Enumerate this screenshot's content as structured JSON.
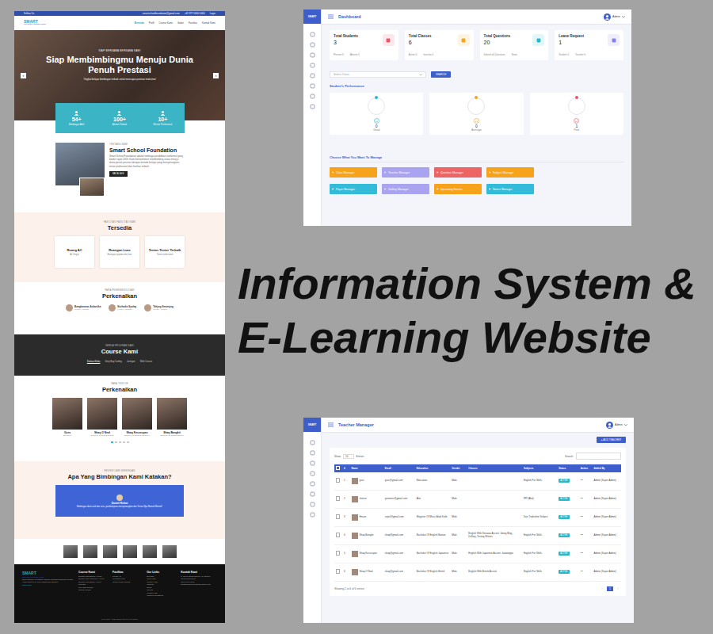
{
  "title": {
    "lines": [
      "Information System &",
      "E-Learning Website"
    ]
  },
  "website": {
    "topbar": {
      "follow": "Follow Us",
      "email": "smartschoolfoundation@gmail.com",
      "phone": "+62 877 0000 0000",
      "login": "Login"
    },
    "nav": {
      "logo": "SMART",
      "logo_sub": "SCHOOL FOUNDATION",
      "items": [
        {
          "label": "Beranda",
          "selected": true
        },
        {
          "label": "Profil",
          "selected": false
        },
        {
          "label": "Course Kami",
          "selected": false
        },
        {
          "label": "Galeri",
          "selected": false
        },
        {
          "label": "Fasilitas",
          "selected": false
        },
        {
          "label": "Kontak Kami",
          "selected": false
        }
      ]
    },
    "hero": {
      "kicker": "SIAP BERSAMA BERSAMA KAMI",
      "title": "Siap Membimbingmu Menuju Dunia Penuh Prestasi",
      "subtitle": "Tingkat belajar bimbingan terbaik untuk mencapai prestasi maksimal",
      "prev": "‹",
      "next": "›"
    },
    "stats": [
      {
        "value": "54+",
        "label": "Bimbingan Aktif"
      },
      {
        "value": "100+",
        "label": "Alumni Terbaik"
      },
      {
        "value": "10+",
        "label": "Mentor Profesional"
      }
    ],
    "about": {
      "kicker": "TENTANG KAMI",
      "title": "Smart School Foundation",
      "text": "Smart School Foundation adalah lembaga pendidikan nonformal yang berdiri sejak 2019. Kami berkomitmen membimbing siswa menuju dunia penuh prestasi dengan metode belajar yang menyenangkan, tentor profesional dan fasilitas terbaik.",
      "button": "BACA LAGI"
    },
    "facilities": {
      "kicker": "FASILITAS FASILITAS KAMI",
      "title": "Tersedia",
      "items": [
        {
          "name": "Ruang AC",
          "desc": "AC Dingin"
        },
        {
          "name": "Ruangan Luas",
          "desc": "Ruangan nyaman dan luas"
        },
        {
          "name": "Tentor-Tentor Terbaik",
          "desc": "Tentor profesional"
        }
      ]
    },
    "mentors": {
      "kicker": "PARA PEMBIMBING KAMI",
      "title": "Perkenalkan",
      "items": [
        {
          "name": "Bangkanmas Ardantika",
          "role": "Mentor - Coding"
        },
        {
          "name": "Nurhadin Syafaq",
          "role": "Mentor - English"
        },
        {
          "name": "Tahyng Sentetyng",
          "role": "Mentor - Design"
        }
      ]
    },
    "courses": {
      "kicker": "SEMUA PROGRAM KAMI",
      "title": "Course Kami",
      "tabs": [
        {
          "label": "Semua Kelas",
          "selected": true
        },
        {
          "label": "Grey Bag Coding",
          "selected": false
        },
        {
          "label": "Jaringan",
          "selected": false
        },
        {
          "label": "Web Course",
          "selected": false
        }
      ]
    },
    "tutors": {
      "kicker": "PARA TENTOR",
      "title": "Perkenalkan",
      "items": [
        {
          "name": "Guru",
          "role": "Education"
        },
        {
          "name": "Shaq O Neal",
          "role": "Bachelor Of English British"
        },
        {
          "name": "Shaq Kesurupan",
          "role": "Bachelor Of English Japanese"
        },
        {
          "name": "Shaq Bangkit",
          "role": "Bachelor Of English Boston"
        }
      ],
      "dots": [
        {
          "selected": true
        },
        {
          "selected": false
        },
        {
          "selected": false
        },
        {
          "selected": false
        },
        {
          "selected": false
        }
      ]
    },
    "reviews": {
      "kicker": "REVIEW DARI BIMBINGAN",
      "title": "Apa Yang Bimbingan Kami Katakan?",
      "name": "Daniel Rohat",
      "quote": "Bimbingan disini asik dan seru, pembelajaran menyenangkan dan Tentor-Nya Ramah-Ramah!"
    },
    "footer": {
      "logo": "SMART",
      "logo_sub": "SCHOOL FOUNDATION",
      "about": "Smart School Foundation adalah lembaga bimbingan belajar yang berdiri di Jl. Raya Tangerang, Banten.",
      "more": "Read More",
      "columns": [
        {
          "title": "Course Kami",
          "links": [
            "English With Boston Accent",
            "English With Japanese Accent",
            "English With British Accent",
            "Jaringan",
            "Grey Bag Coding",
            "Testing Writing"
          ]
        },
        {
          "title": "Fasilitas",
          "links": [
            "Ruang AC",
            "Ruangan Luas",
            "Tentor-Tentor Terbaik"
          ]
        },
        {
          "title": "Our Links",
          "links": [
            "Beranda",
            "Profil Kami",
            "Course Kami",
            "Fasilitas",
            "Galeri",
            "Review",
            "Kontak Kami",
            "Terms & Conditions"
          ]
        },
        {
          "title": "Kontak Kami",
          "links": [
            "Jl. Raya Tangerang No. 10, Banten",
            "Tangerang 15000",
            "0877 0000 0000",
            "smartschoolfoundation@gmail.com"
          ]
        }
      ],
      "copyright": "Copyright © 2021 Smart School Foundation"
    }
  },
  "dashboard": {
    "logo": "SMART",
    "header": {
      "title": "Dashboard",
      "user": "Admin"
    },
    "cards": [
      {
        "title": "Total Students",
        "value": "3",
        "left": "Present 0",
        "right": "Absent 0",
        "color": "#e8566a"
      },
      {
        "title": "Total Classes",
        "value": "6",
        "left": "Active 6",
        "right": "Inactive 0",
        "color": "#f3a51c"
      },
      {
        "title": "Total Questions",
        "value": "20",
        "left": "Solved all Questions",
        "right": "None",
        "color": "#27b9c9"
      },
      {
        "title": "Leave Request",
        "value": "1",
        "left": "Student 0",
        "right": "Teacher 0",
        "color": "#8b80e8"
      }
    ],
    "select": {
      "placeholder": "Select Class"
    },
    "search_button": "SEARCH",
    "performance_title": "Student's Performance",
    "performance": [
      {
        "value": "0",
        "label": "Good",
        "color": "#27b9c9"
      },
      {
        "value": "0",
        "label": "Average",
        "color": "#f3a51c"
      },
      {
        "value": "1",
        "label": "Poor",
        "color": "#e8566a"
      }
    ],
    "manage_title": "Choose What You Want To Manage",
    "managers": [
      {
        "label": "Class Manager",
        "color": "#f7a21b"
      },
      {
        "label": "Teacher Manager",
        "color": "#a9a3f0"
      },
      {
        "label": "Question Manager",
        "color": "#ee6464"
      },
      {
        "label": "Subject Manager",
        "color": "#f7a21b"
      },
      {
        "label": "Paper Manager",
        "color": "#33bcd9"
      },
      {
        "label": "Gallery Manager",
        "color": "#a9a3f0"
      },
      {
        "label": "Upcoming Events",
        "color": "#f7a21b"
      },
      {
        "label": "Notice Manager",
        "color": "#33bcd9"
      }
    ]
  },
  "teacher_manager": {
    "logo": "SMART",
    "header": {
      "title": "Teacher Manager",
      "user": "Admin"
    },
    "add_button": {
      "icon": "+",
      "label": "ADD TEACHER"
    },
    "show": {
      "label": "Show",
      "value": "10",
      "suffix": "Entries"
    },
    "search_label": "Search:",
    "columns": [
      "#",
      "Name",
      "Email",
      "Education",
      "Gender",
      "Classes",
      "Subjects",
      "Status",
      "Action",
      "Added By"
    ],
    "rows": [
      {
        "checked": false,
        "no": "1",
        "name": "guru",
        "email": "guru@gmail.com",
        "education": "Education",
        "gender": "Male",
        "classes": "",
        "subjects": "English For Skills",
        "status": "ACTIVE",
        "action": "•••",
        "added_by": "Admin (Super Admin)"
      },
      {
        "checked": false,
        "no": "2",
        "name": "shinsei",
        "email": "greatnes@gmail.com",
        "education": "Alat",
        "gender": "Male",
        "classes": "",
        "subjects": "PPI (Alat)",
        "status": "ACTIVE",
        "action": "•••",
        "added_by": "Admin (Super Admin)"
      },
      {
        "checked": false,
        "no": "3",
        "name": "Hesan",
        "email": "sepul@gmail.com",
        "education": "Magister Of Music Arab Kalbi",
        "gender": "Male",
        "classes": "",
        "subjects": "Dan Tradisiline Subject",
        "status": "ACTIVE",
        "action": "•••",
        "added_by": "Admin (Super Admin)"
      },
      {
        "checked": false,
        "no": "4",
        "name": "Shaq Bangkit",
        "email": "shaq@gmail.com",
        "education": "Bachelor Of English Boston",
        "gender": "Male",
        "classes": "English With Ilmuwan Accent, Going Blog, Drilling, Testing Writers",
        "subjects": "English For Skills",
        "status": "ACTIVE",
        "action": "•••",
        "added_by": "Admin (Super Admin)"
      },
      {
        "checked": false,
        "no": "5",
        "name": "Shaq Kesurupan",
        "email": "shaq@gmail.com",
        "education": "Bachelor Of English Japanese",
        "gender": "Male",
        "classes": "English With Japanese Accent, Jawatoppa",
        "subjects": "English For Skills",
        "status": "ACTIVE",
        "action": "•••",
        "added_by": "Admin (Super Admin)"
      },
      {
        "checked": false,
        "no": "6",
        "name": "Shaq O Neal",
        "email": "shaq@gmail.com",
        "education": "Bachelor Of English British",
        "gender": "Male",
        "classes": "English With British Accent",
        "subjects": "English For Skills",
        "status": "ACTIVE",
        "action": "•••",
        "added_by": "Admin (Super Admin)"
      }
    ],
    "footer": "Showing 1 to 6 of 6 entries",
    "pages": [
      {
        "label": "‹",
        "selected": false
      },
      {
        "label": "1",
        "selected": true
      },
      {
        "label": "›",
        "selected": false
      }
    ]
  }
}
